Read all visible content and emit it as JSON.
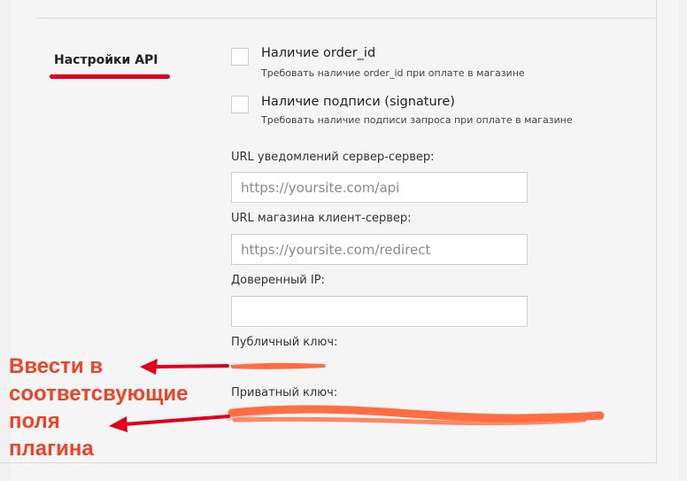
{
  "section": {
    "title": "Настройки API"
  },
  "checkboxes": [
    {
      "label": "Наличие order_id",
      "hint": "Требовать наличие order_id при оплате в магазине",
      "checked": false
    },
    {
      "label": "Наличие подписи (signature)",
      "hint": "Требовать наличие подписи запроса при оплате в магазине",
      "checked": false
    }
  ],
  "fields": {
    "server_url": {
      "label": "URL уведомлений сервер-сервер:",
      "placeholder": "https://yoursite.com/api",
      "value": ""
    },
    "client_url": {
      "label": "URL магазина клиент-сервер:",
      "placeholder": "https://yoursite.com/redirect",
      "value": ""
    },
    "trusted_ip": {
      "label": "Доверенный IP:",
      "placeholder": "",
      "value": ""
    },
    "public_key": {
      "label": "Публичный ключ:"
    },
    "private_key": {
      "label": "Приватный ключ:"
    }
  },
  "annotation": {
    "lines": [
      "Ввести в",
      "соответсвующие",
      "поля",
      "плагина"
    ],
    "color": "#ef4327",
    "underline_color": "#e3001b",
    "redaction_color": "#ff6d40"
  }
}
